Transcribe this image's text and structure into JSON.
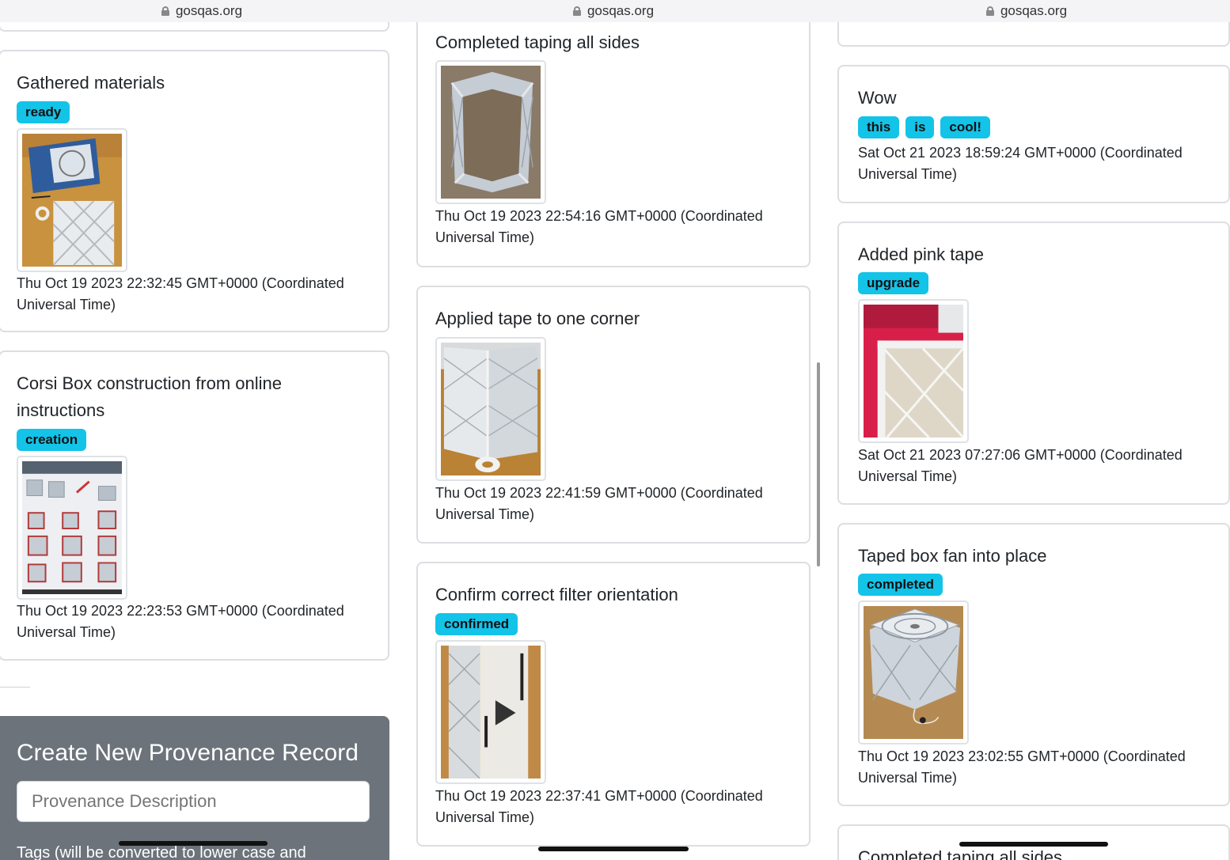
{
  "url_bars": [
    "gosqas.org",
    "gosqas.org",
    "gosqas.org"
  ],
  "left": {
    "cards": [
      {
        "title": "Gathered materials",
        "tags": [
          "ready"
        ],
        "timestamp_line1": "Thu Oct 19 2023 22:32:45 GMT+0000 (Coordinated",
        "timestamp_line2": "Universal Time)"
      },
      {
        "title_line1": "Corsi Box construction from online",
        "title_line2": "instructions",
        "tags": [
          "creation"
        ],
        "timestamp_line1": "Thu Oct 19 2023 22:23:53 GMT+0000 (Coordinated",
        "timestamp_line2": "Universal Time)"
      }
    ],
    "form": {
      "title": "Create New Provenance Record",
      "description_placeholder": "Provenance Description",
      "tags_hint": "Tags (will be converted to lower case and"
    }
  },
  "middle": {
    "cards": [
      {
        "title": "Completed taping all sides",
        "tags": [],
        "timestamp_line1": "Thu Oct 19 2023 22:54:16 GMT+0000 (Coordinated",
        "timestamp_line2": "Universal Time)"
      },
      {
        "title": "Applied tape to one corner",
        "tags": [],
        "timestamp_line1": "Thu Oct 19 2023 22:41:59 GMT+0000 (Coordinated",
        "timestamp_line2": "Universal Time)"
      },
      {
        "title": "Confirm correct filter orientation",
        "tags": [
          "confirmed"
        ],
        "timestamp_line1": "Thu Oct 19 2023 22:37:41 GMT+0000 (Coordinated",
        "timestamp_line2": "Universal Time)"
      }
    ]
  },
  "right": {
    "cards": [
      {
        "title": "Wow",
        "tags": [
          "this",
          "is",
          "cool!"
        ],
        "timestamp_line1": "Sat Oct 21 2023 18:59:24 GMT+0000 (Coordinated",
        "timestamp_line2": "Universal Time)"
      },
      {
        "title": "Added pink tape",
        "tags": [
          "upgrade"
        ],
        "timestamp_line1": "Sat Oct 21 2023 07:27:06 GMT+0000 (Coordinated",
        "timestamp_line2": "Universal Time)"
      },
      {
        "title": "Taped box fan into place",
        "tags": [
          "completed"
        ],
        "timestamp_line1": "Thu Oct 19 2023 23:02:55 GMT+0000 (Coordinated",
        "timestamp_line2": "Universal Time)"
      },
      {
        "title": "Completed taping all sides"
      }
    ]
  },
  "colors": {
    "tag_bg": "#14c3e8",
    "form_bg": "#6c737b",
    "card_border": "#dcdee2"
  },
  "icons": [
    "lock-icon"
  ]
}
